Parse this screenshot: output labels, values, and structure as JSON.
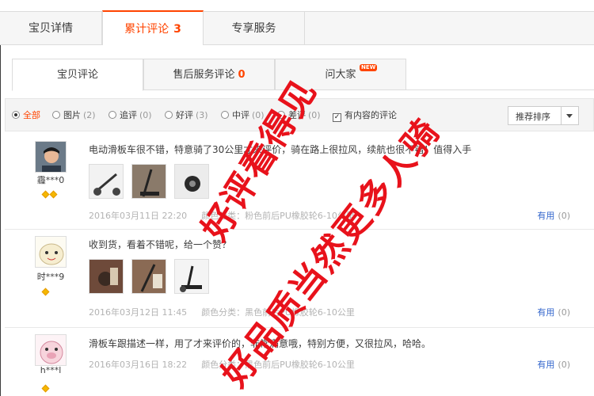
{
  "top_tabs": [
    {
      "label": "宝贝详情"
    },
    {
      "label": "累计评论",
      "count": "3"
    },
    {
      "label": "专享服务"
    }
  ],
  "sub_tabs": [
    {
      "label": "宝贝评论"
    },
    {
      "label": "售后服务评论",
      "count": "0"
    },
    {
      "label": "问大家",
      "badge": "NEW"
    }
  ],
  "filters": [
    {
      "label": "全部",
      "active": true
    },
    {
      "label": "图片",
      "count": "(2)"
    },
    {
      "label": "追评",
      "count": "(0)"
    },
    {
      "label": "好评",
      "count": "(3)"
    },
    {
      "label": "中评",
      "count": "(0)"
    },
    {
      "label": "差评",
      "count": "(0)"
    }
  ],
  "content_filter": {
    "label": "有内容的评论",
    "checked": true
  },
  "sort": {
    "label": "推荐排序"
  },
  "reviews": [
    {
      "user": "霾***0",
      "text": "电动滑板车很不错，特意骑了30公里才来评价，骑在路上很拉风，续航也很不错！值得入手",
      "date": "2016年03月11日 22:20",
      "attr": "颜色分类：粉色前后PU橡胶轮6-10公里",
      "useful": "有用",
      "useful_count": "(0)"
    },
    {
      "user": "时***9",
      "text": "收到货，看着不错呢，给一个赞？",
      "date": "2016年03月12日 11:45",
      "attr": "颜色分类：黑色前后PU橡胶轮6-10公里",
      "useful": "有用",
      "useful_count": "(0)"
    },
    {
      "user": "h***l",
      "text": "滑板车跟描述一样，用了才来评价的，非常满意哦，特别方便，又很拉风，哈哈。",
      "date": "2016年03月16日 18:22",
      "attr": "颜色分类：黑色前后PU橡胶轮6-10公里",
      "useful": "有用",
      "useful_count": "(0)"
    }
  ],
  "watermark": {
    "line1": "好评看得见",
    "line2": "好品质当然更多人骑"
  },
  "colors": {
    "accent": "#ff4400",
    "link": "#3366cc",
    "watermark": "#e8121b"
  }
}
